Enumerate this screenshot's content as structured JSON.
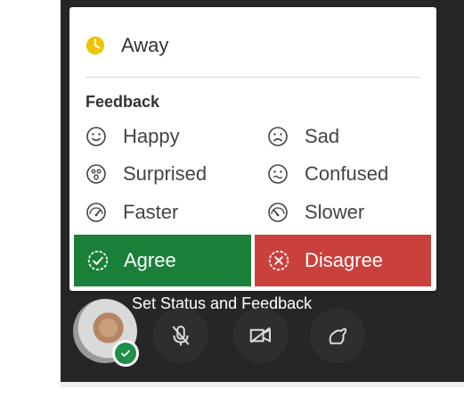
{
  "menu": {
    "away_label": "Away",
    "feedback_heading": "Feedback",
    "feedback_items": [
      {
        "label": "Happy"
      },
      {
        "label": "Sad"
      },
      {
        "label": "Surprised"
      },
      {
        "label": "Confused"
      },
      {
        "label": "Faster"
      },
      {
        "label": "Slower"
      }
    ],
    "agree_label": "Agree",
    "disagree_label": "Disagree"
  },
  "tooltip": "Set Status and Feedback",
  "colors": {
    "agree": "#1a8039",
    "disagree": "#c9403c",
    "away_icon": "#f2c300",
    "status_badge": "#1f8f49",
    "panel": "#262626"
  },
  "icons": [
    "clock-icon",
    "happy-face-icon",
    "sad-face-icon",
    "surprised-face-icon",
    "confused-face-icon",
    "faster-icon",
    "slower-icon",
    "agree-icon",
    "disagree-icon",
    "check-icon",
    "mic-icon",
    "camera-icon",
    "hand-icon"
  ]
}
